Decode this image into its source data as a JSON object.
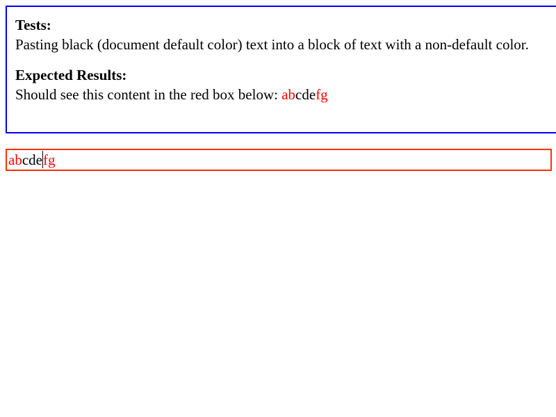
{
  "instructions": {
    "tests_heading": "Tests:",
    "tests_text": "Pasting black (document default color) text into a block of text with a non-default color.",
    "expected_heading": "Expected Results:",
    "expected_text": "Should see this content in the red box below:",
    "expected_sample": {
      "part1": "ab",
      "part2": "cde",
      "part3": "fg"
    }
  },
  "editor": {
    "segments": {
      "red_start": "ab",
      "black_middle": "cde",
      "red_end": "fg"
    },
    "caret_after": "cde"
  },
  "colors": {
    "info_border": "#0000ff",
    "editor_border": "#ff3000",
    "red_text": "#ff0000",
    "default_text": "#000000"
  }
}
